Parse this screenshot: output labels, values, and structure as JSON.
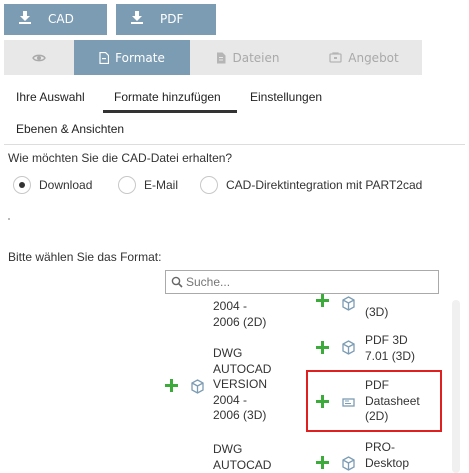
{
  "download_buttons": [
    {
      "label": "CAD",
      "icon": "download-icon"
    },
    {
      "label": "PDF",
      "icon": "download-icon"
    }
  ],
  "tabs": [
    {
      "label": "",
      "icon": "eye-icon",
      "active": false
    },
    {
      "label": "Formate",
      "icon": "document-icon",
      "active": true
    },
    {
      "label": "Dateien",
      "icon": "file-icon",
      "active": false
    },
    {
      "label": "Angebot",
      "icon": "cart-icon",
      "active": false
    }
  ],
  "subnav": {
    "items": [
      "Ihre Auswahl",
      "Formate hinzufügen",
      "Einstellungen",
      "Ebenen & Ansichten"
    ],
    "active_index": 1
  },
  "delivery": {
    "question": "Wie möchten Sie die CAD-Datei erhalten?",
    "options": [
      "Download",
      "E-Mail",
      "CAD-Direktintegration mit PART2cad"
    ],
    "selected_index": 0
  },
  "format": {
    "label": "Bitte wählen Sie das Format:",
    "search_placeholder": "Suche...",
    "left_column": [
      "2004 -\n2006 (2D)",
      "DWG\nAUTOCAD\nVERSION\n2004 -\n2006 (3D)",
      "DWG\nAUTOCAD"
    ],
    "right_column": [
      "(3D)",
      "PDF 3D\n7.01 (3D)",
      "PDF\nDatasheet\n(2D)",
      "PRO-\nDesktop"
    ],
    "highlighted": "PDF Datasheet (2D)"
  },
  "colors": {
    "accent": "#7c9cb4",
    "tab_bg": "#e8e8e8",
    "plus": "#3cab3c",
    "highlight": "#e02020"
  }
}
